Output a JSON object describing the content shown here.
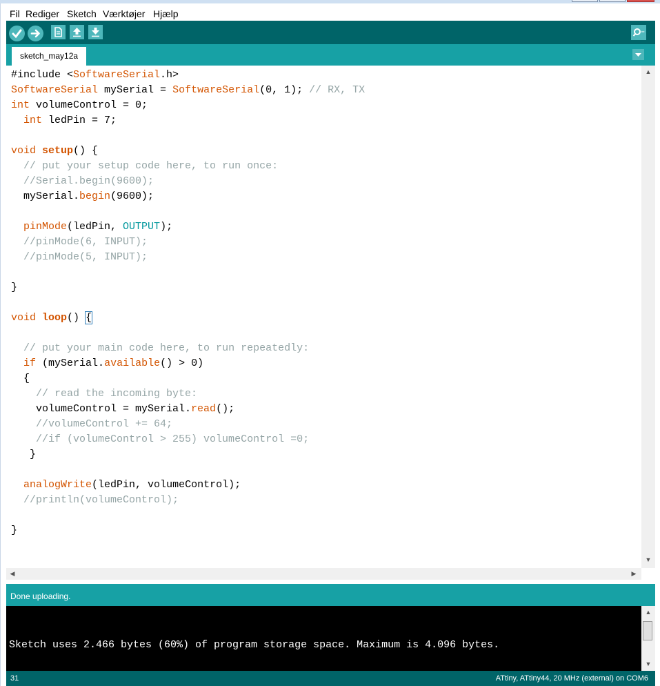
{
  "menu": [
    "Fil",
    "Rediger",
    "Sketch",
    "Værktøjer",
    "Hjælp"
  ],
  "tab": {
    "label": "sketch_may12a"
  },
  "editor": {
    "lines": [
      [
        {
          "t": "#include <"
        },
        {
          "t": "SoftwareSerial",
          "c": "kw"
        },
        {
          "t": ".h>"
        }
      ],
      [
        {
          "t": "SoftwareSerial",
          "c": "kw"
        },
        {
          "t": " mySerial = "
        },
        {
          "t": "SoftwareSerial",
          "c": "kw"
        },
        {
          "t": "(0, 1); "
        },
        {
          "t": "// RX, TX",
          "c": "ct"
        }
      ],
      [
        {
          "t": "int",
          "c": "kw"
        },
        {
          "t": " volumeControl = 0;"
        }
      ],
      [
        {
          "t": "  "
        },
        {
          "t": "int",
          "c": "kw"
        },
        {
          "t": " ledPin = 7;"
        }
      ],
      [
        {
          "t": ""
        }
      ],
      [
        {
          "t": "void",
          "c": "kw"
        },
        {
          "t": " "
        },
        {
          "t": "setup",
          "c": "kwb"
        },
        {
          "t": "() {"
        }
      ],
      [
        {
          "t": "  "
        },
        {
          "t": "// put your setup code here, to run once:",
          "c": "ct"
        }
      ],
      [
        {
          "t": "  "
        },
        {
          "t": "//Serial.begin(9600);",
          "c": "ct"
        }
      ],
      [
        {
          "t": "  mySerial."
        },
        {
          "t": "begin",
          "c": "kw"
        },
        {
          "t": "(9600);"
        }
      ],
      [
        {
          "t": ""
        }
      ],
      [
        {
          "t": "  "
        },
        {
          "t": "pinMode",
          "c": "kw"
        },
        {
          "t": "(ledPin, "
        },
        {
          "t": "OUTPUT",
          "c": "cst"
        },
        {
          "t": ");"
        }
      ],
      [
        {
          "t": "  "
        },
        {
          "t": "//pinMode(6, INPUT);",
          "c": "ct"
        }
      ],
      [
        {
          "t": "  "
        },
        {
          "t": "//pinMode(5, INPUT);",
          "c": "ct"
        }
      ],
      [
        {
          "t": ""
        }
      ],
      [
        {
          "t": "}"
        }
      ],
      [
        {
          "t": ""
        }
      ],
      [
        {
          "t": "void",
          "c": "kw"
        },
        {
          "t": " "
        },
        {
          "t": "loop",
          "c": "kwb"
        },
        {
          "t": "() "
        },
        {
          "t": "{",
          "c": "cursor-brace"
        }
      ],
      [
        {
          "t": ""
        }
      ],
      [
        {
          "t": "  "
        },
        {
          "t": "// put your main code here, to run repeatedly:",
          "c": "ct"
        }
      ],
      [
        {
          "t": "  "
        },
        {
          "t": "if",
          "c": "kw"
        },
        {
          "t": " (mySerial."
        },
        {
          "t": "available",
          "c": "kw"
        },
        {
          "t": "() > 0)"
        }
      ],
      [
        {
          "t": "  {"
        }
      ],
      [
        {
          "t": "    "
        },
        {
          "t": "// read the incoming byte:",
          "c": "ct"
        }
      ],
      [
        {
          "t": "    volumeControl = mySerial."
        },
        {
          "t": "read",
          "c": "kw"
        },
        {
          "t": "();"
        }
      ],
      [
        {
          "t": "    "
        },
        {
          "t": "//volumeControl += 64;",
          "c": "ct"
        }
      ],
      [
        {
          "t": "    "
        },
        {
          "t": "//if (volumeControl > 255) volumeControl =0;",
          "c": "ct"
        }
      ],
      [
        {
          "t": "   }"
        }
      ],
      [
        {
          "t": ""
        }
      ],
      [
        {
          "t": "  "
        },
        {
          "t": "analogWrite",
          "c": "kw"
        },
        {
          "t": "(ledPin, volumeControl);"
        }
      ],
      [
        {
          "t": "  "
        },
        {
          "t": "//println(volumeControl);",
          "c": "ct"
        }
      ],
      [
        {
          "t": ""
        }
      ],
      [
        {
          "t": "}"
        }
      ]
    ]
  },
  "status": {
    "message": "Done uploading."
  },
  "console": {
    "text": "Sketch uses 2.466 bytes (60%) of program storage space. Maximum is 4.096 bytes."
  },
  "footer": {
    "line_number": "31",
    "board": "ATtiny, ATtiny44, 20 MHz (external) on COM6"
  },
  "icons": {
    "verify": "checkmark-icon",
    "upload": "arrow-right-icon",
    "new": "new-file-icon",
    "open": "open-arrow-up-icon",
    "save": "save-arrow-down-icon",
    "serial_monitor": "magnifier-icon",
    "tab_menu": "triangle-down-icon"
  },
  "colors": {
    "toolbar": "#006468",
    "tabbar": "#17a1a5",
    "button": "#4db7bb",
    "keyword": "#d35400",
    "comment": "#95a5a6",
    "constant": "#00979c"
  }
}
